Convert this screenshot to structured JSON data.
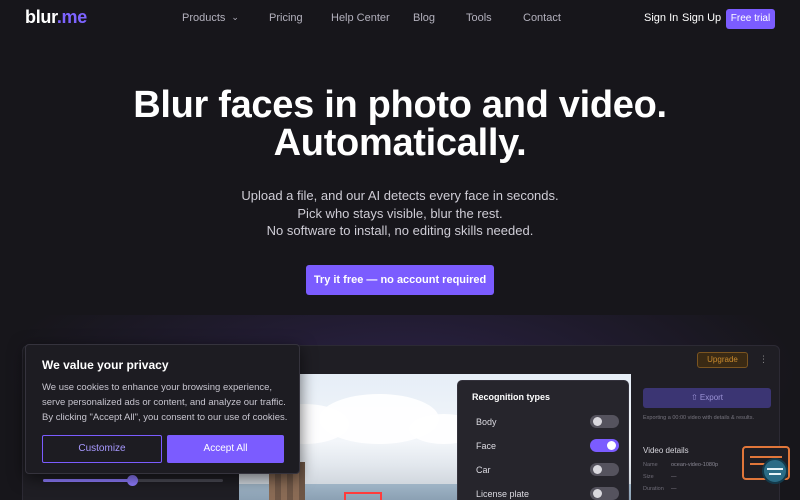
{
  "nav": {
    "logo_main": "blur",
    "logo_accent": ".me",
    "links": [
      "Products",
      "Pricing",
      "Help Center",
      "Blog",
      "Tools",
      "Contact"
    ],
    "sign_in": "Sign In",
    "sign_up": "Sign Up",
    "free_trial": "Free trial"
  },
  "hero": {
    "title_line1": "Blur faces in photo and video.",
    "title_line2": "Automatically.",
    "sub_line1": "Upload a file, and our AI detects every face in seconds.",
    "sub_line2": "Pick who stays visible, blur the rest.",
    "sub_line3": "No software to install, no editing skills needed.",
    "cta": "Try it free — no account required"
  },
  "app_preview": {
    "upgrade": "Upgrade",
    "panel_title": "Recognition types",
    "recognition_types": [
      {
        "label": "Body",
        "on": false
      },
      {
        "label": "Face",
        "on": true
      },
      {
        "label": "Car",
        "on": false
      },
      {
        "label": "License plate",
        "on": false
      }
    ],
    "export": "Export",
    "export_note": "Exporting a 00:00 video with details & results.",
    "video_details_title": "Video details",
    "video_details": [
      {
        "key": "Name",
        "value": "ocean-video-1080p"
      },
      {
        "key": "Size",
        "value": "—"
      },
      {
        "key": "Duration",
        "value": "—"
      }
    ],
    "slider_value": 0.5
  },
  "cookie": {
    "title": "We value your privacy",
    "text": "We use cookies to enhance your browsing experience, serve personalized ads or content, and analyze our traffic. By clicking \"Accept All\", you consent to our use of cookies.",
    "customize": "Customize",
    "accept_all": "Accept All"
  },
  "colors": {
    "accent": "#7b5cff",
    "background": "#17161b"
  }
}
